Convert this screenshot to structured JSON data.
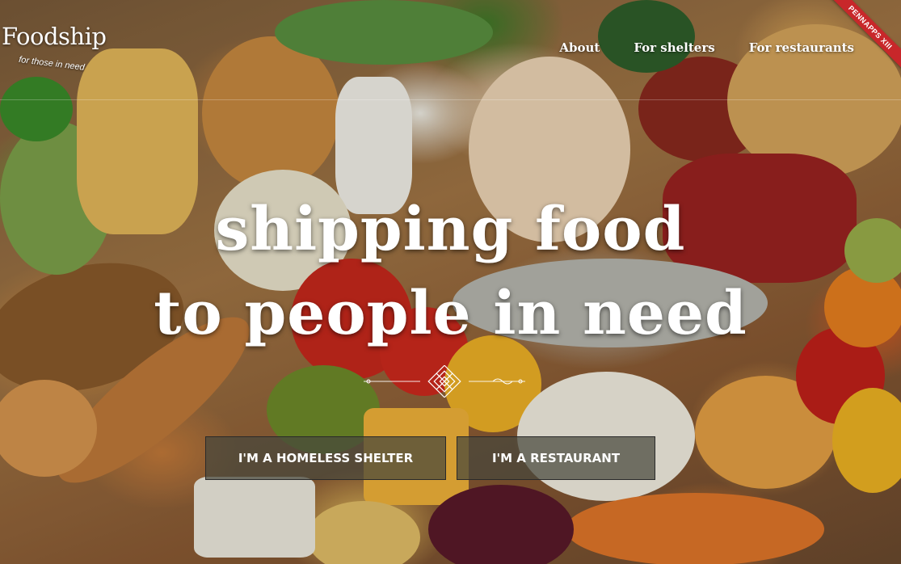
{
  "brand": {
    "name": "Foodship",
    "tagline": "for those in need"
  },
  "nav": {
    "items": [
      {
        "label": "About"
      },
      {
        "label": "For shelters"
      },
      {
        "label": "For restaurants"
      }
    ]
  },
  "ribbon": {
    "label": "PENNAPPS XIII",
    "color": "#c8272a"
  },
  "hero": {
    "headline_line1": "shipping food",
    "headline_line2": "to people in need"
  },
  "actions": {
    "shelter_label": "I'M A HOMELESS SHELTER",
    "restaurant_label": "I'M A RESTAURANT"
  },
  "icons": {
    "divider": "ornament-divider-icon"
  }
}
